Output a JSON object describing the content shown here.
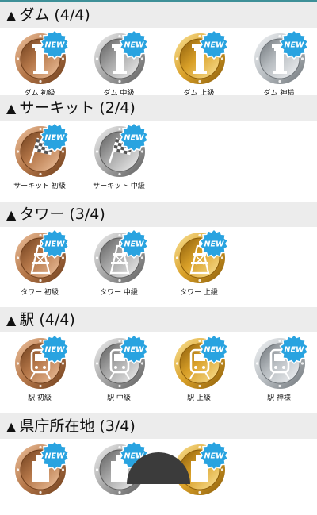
{
  "new_label": "NEW",
  "sections": [
    {
      "arrow": "▲",
      "title": "ダム (4/4)",
      "icon": "dam-icon",
      "badges": [
        {
          "label": "ダム 初級",
          "tier": "bronze",
          "is_new": true
        },
        {
          "label": "ダム 中級",
          "tier": "silver",
          "is_new": true
        },
        {
          "label": "ダム 上級",
          "tier": "gold",
          "is_new": true
        },
        {
          "label": "ダム 神様",
          "tier": "platinum",
          "is_new": true
        }
      ]
    },
    {
      "arrow": "▲",
      "title": "サーキット (2/4)",
      "icon": "checkered-flag-icon",
      "badges": [
        {
          "label": "サーキット 初級",
          "tier": "bronze",
          "is_new": true
        },
        {
          "label": "サーキット 中級",
          "tier": "silver",
          "is_new": true
        }
      ]
    },
    {
      "arrow": "▲",
      "title": "タワー (3/4)",
      "icon": "tower-icon",
      "badges": [
        {
          "label": "タワー 初級",
          "tier": "bronze",
          "is_new": true
        },
        {
          "label": "タワー 中級",
          "tier": "silver",
          "is_new": true
        },
        {
          "label": "タワー 上級",
          "tier": "gold",
          "is_new": true
        }
      ]
    },
    {
      "arrow": "▲",
      "title": "駅 (4/4)",
      "icon": "train-icon",
      "badges": [
        {
          "label": "駅 初級",
          "tier": "bronze",
          "is_new": true
        },
        {
          "label": "駅 中級",
          "tier": "silver",
          "is_new": true
        },
        {
          "label": "駅 上級",
          "tier": "gold",
          "is_new": true
        },
        {
          "label": "駅 神様",
          "tier": "platinum",
          "is_new": true
        }
      ]
    },
    {
      "arrow": "▲",
      "title": "県庁所在地 (3/4)",
      "icon": "building-icon",
      "badges": [
        {
          "label": "",
          "tier": "bronze",
          "is_new": true
        },
        {
          "label": "",
          "tier": "silver",
          "is_new": true
        },
        {
          "label": "",
          "tier": "gold",
          "is_new": true
        }
      ]
    }
  ],
  "colors": {
    "header_bg": "#ececec",
    "new_badge": "#29a3e0",
    "bronze": "#b57749",
    "silver": "#a7a7a7",
    "gold": "#d9a028",
    "platinum": "#b9bec2"
  }
}
